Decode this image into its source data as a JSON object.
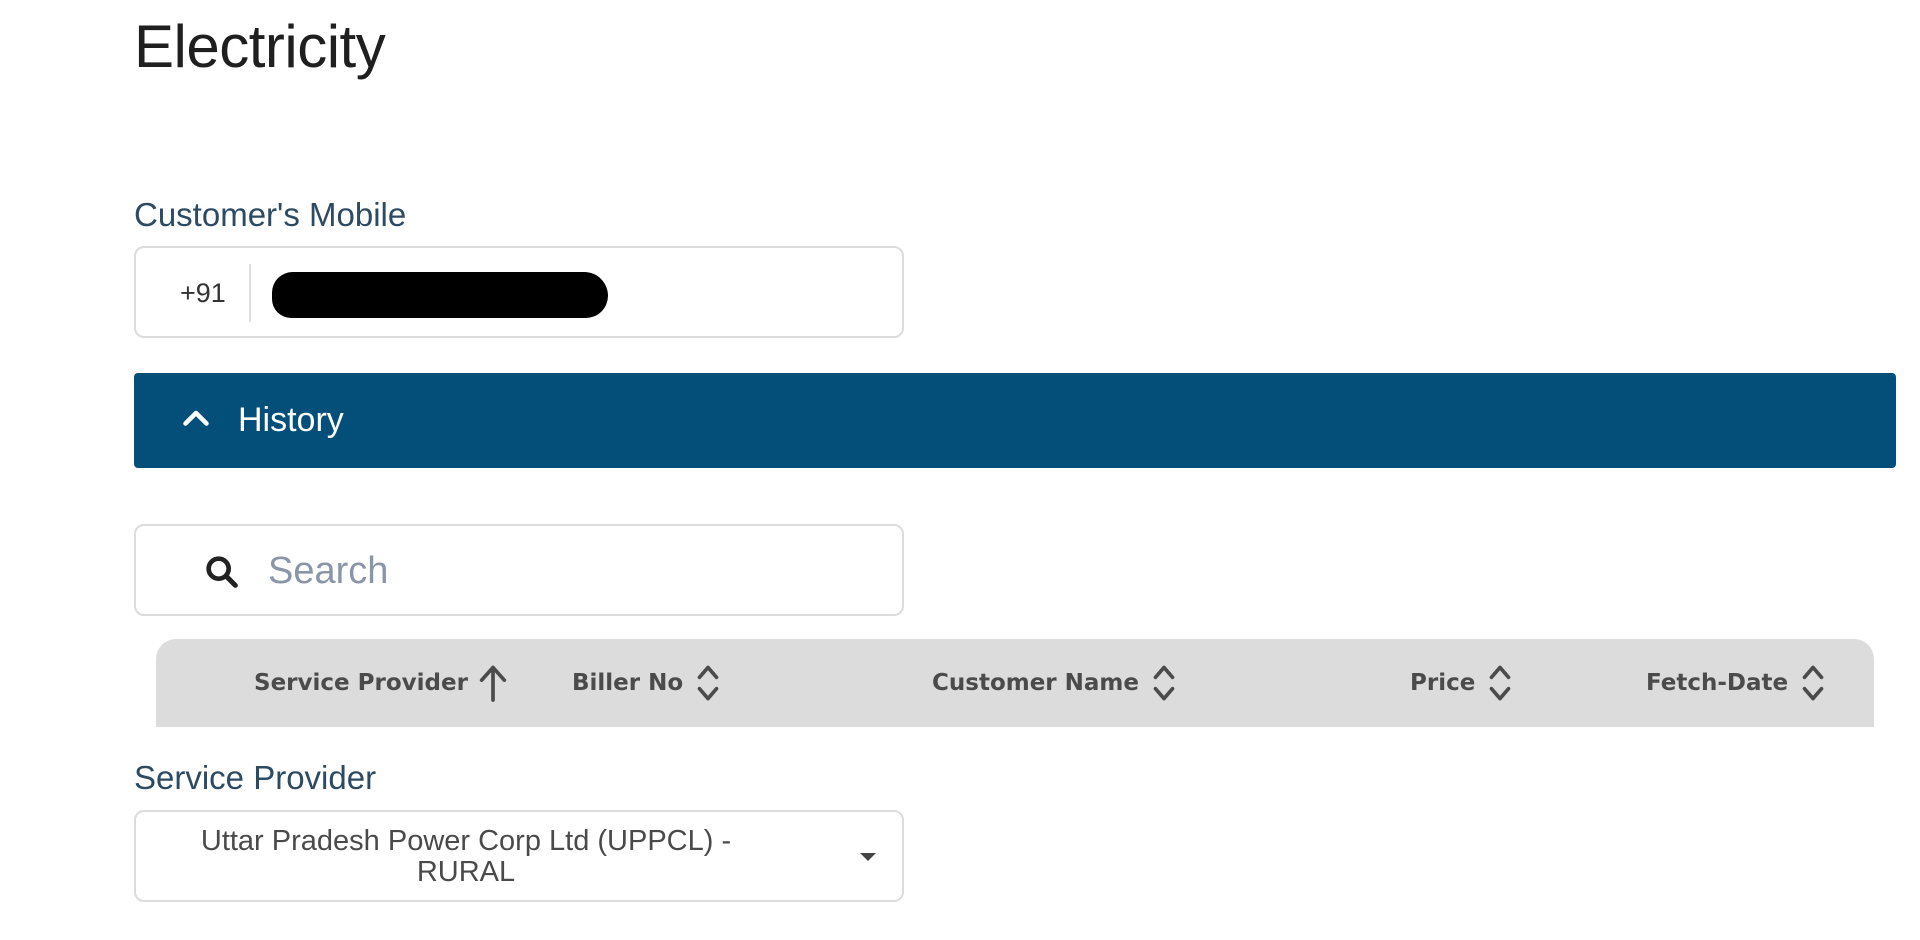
{
  "page": {
    "title": "Electricity"
  },
  "mobile": {
    "label": "Customer's Mobile",
    "country_code": "+91",
    "value_redacted": true
  },
  "history": {
    "label": "History",
    "expanded": true,
    "icon": "chevron-up-icon",
    "bar_color": "#034f7a"
  },
  "search": {
    "placeholder": "Search",
    "value": "",
    "icon": "search-icon"
  },
  "table": {
    "header_bg": "#dcdcdc",
    "columns": [
      {
        "label": "Service Provider",
        "sort": "ascending",
        "icon": "arrow-up-icon"
      },
      {
        "label": "Biller No",
        "sort": "none",
        "icon": "sort-icon"
      },
      {
        "label": "Customer Name",
        "sort": "none",
        "icon": "sort-icon"
      },
      {
        "label": "Price",
        "sort": "none",
        "icon": "sort-icon"
      },
      {
        "label": "Fetch-Date",
        "sort": "none",
        "icon": "sort-icon"
      }
    ]
  },
  "service_provider": {
    "label": "Service Provider",
    "selected_line1": "Uttar Pradesh Power Corp Ltd (UPPCL) -",
    "selected_line2": "RURAL",
    "icon": "caret-down-icon"
  }
}
